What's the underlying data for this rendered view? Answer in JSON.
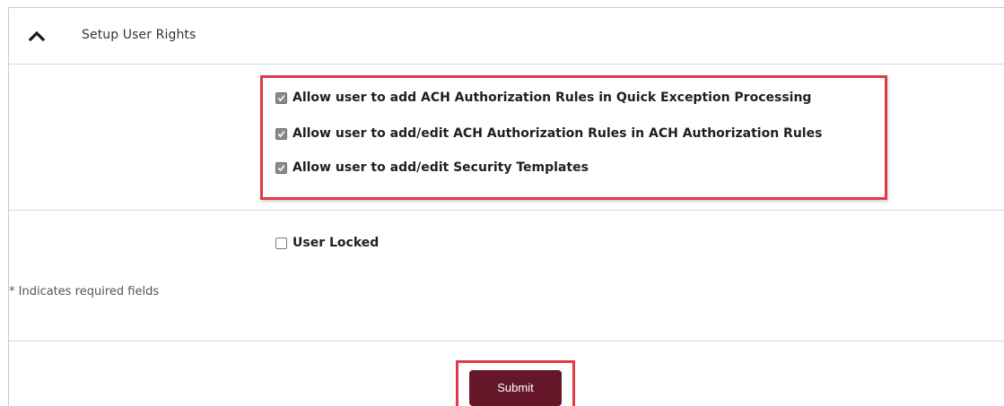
{
  "section": {
    "title": "Setup User Rights",
    "toggle_icon": "chevron-up-icon"
  },
  "user_rights": [
    {
      "label": "Allow user to add ACH Authorization Rules in Quick Exception Processing",
      "checked": true
    },
    {
      "label": "Allow user to add/edit ACH Authorization Rules in ACH Authorization Rules",
      "checked": true
    },
    {
      "label": "Allow user to add/edit Security Templates",
      "checked": true
    }
  ],
  "user_locked": {
    "label": "User Locked",
    "checked": false
  },
  "required_note": "* Indicates required fields",
  "submit": {
    "label": "Submit"
  },
  "colors": {
    "highlight": "#e03a44",
    "submit_bg": "#651729",
    "checkbox_checked": "#8a8a8a"
  }
}
